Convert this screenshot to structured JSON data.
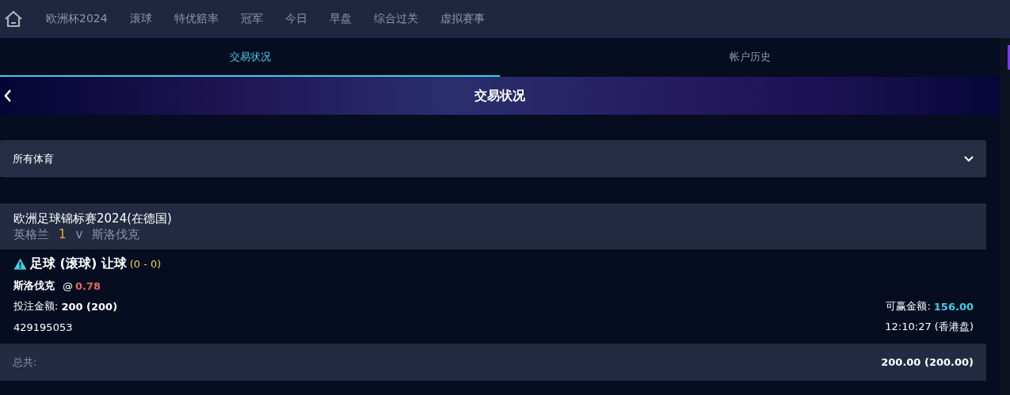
{
  "nav": {
    "items": [
      {
        "label": "欧洲杯2024"
      },
      {
        "label": "滚球"
      },
      {
        "label": "特优赔率"
      },
      {
        "label": "冠军"
      },
      {
        "label": "今日"
      },
      {
        "label": "早盘"
      },
      {
        "label": "综合过关"
      },
      {
        "label": "虚拟赛事"
      }
    ]
  },
  "tabs": [
    {
      "label": "交易状况",
      "selected": true
    },
    {
      "label": "帐户历史",
      "selected": false
    }
  ],
  "banner": {
    "title": "交易状况"
  },
  "filter": {
    "value": "所有体育"
  },
  "event": {
    "league": "欧洲足球锦标赛2024(在德国)",
    "home": "英格兰",
    "score": "1",
    "versus": "v",
    "away": "斯洛伐克"
  },
  "bet": {
    "market": "足球 (滚球) 让球",
    "market_score": "(0 - 0)",
    "selection": "斯洛伐克",
    "at": "@",
    "odds": "0.78",
    "stake_label": "投注金额:",
    "stake": "200 (200)",
    "win_label": "可赢金额:",
    "win": "156.00",
    "ticket": "429195053",
    "time": "12:10:27 (香港盘)"
  },
  "total": {
    "label": "总共:",
    "value": "200.00 (200.00)"
  }
}
